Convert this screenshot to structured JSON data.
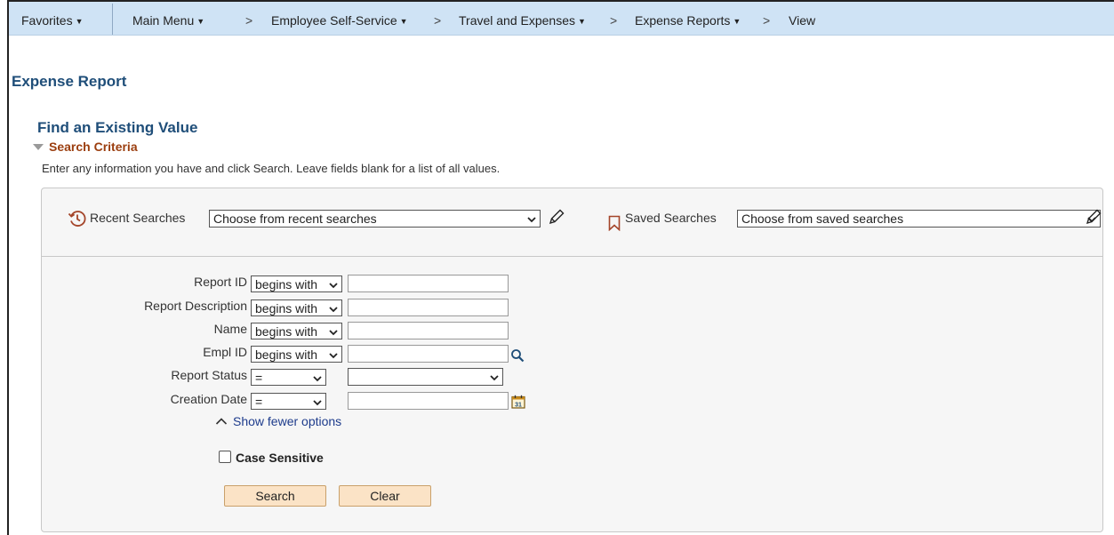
{
  "nav": {
    "favorites": "Favorites",
    "main_menu": "Main Menu",
    "breadcrumbs": [
      "Employee Self-Service",
      "Travel and Expenses",
      "Expense Reports",
      "View"
    ]
  },
  "page": {
    "title": "Expense Report",
    "find_title": "Find an Existing Value",
    "criteria_label": "Search Criteria",
    "instructions": "Enter any information you have and click Search. Leave fields blank for a list of all values."
  },
  "recent": {
    "label": "Recent Searches",
    "value": "Choose from recent searches"
  },
  "saved": {
    "label": "Saved Searches",
    "value": "Choose from saved searches"
  },
  "fields": [
    {
      "label": "Report ID",
      "operator": "begins with",
      "value": ""
    },
    {
      "label": "Report Description",
      "operator": "begins with",
      "value": ""
    },
    {
      "label": "Name",
      "operator": "begins with",
      "value": ""
    },
    {
      "label": "Empl ID",
      "operator": "begins with",
      "value": ""
    },
    {
      "label": "Report Status",
      "operator": "=",
      "value": ""
    },
    {
      "label": "Creation Date",
      "operator": "=",
      "value": ""
    }
  ],
  "show_fewer": "Show fewer options",
  "case_sensitive": {
    "label": "Case Sensitive",
    "checked": false
  },
  "buttons": {
    "search": "Search",
    "clear": "Clear"
  },
  "colors": {
    "nav_bg": "#cfe3f5",
    "title": "#1f4e79",
    "criteria": "#9b3e0f",
    "button_bg": "#fbe3c6"
  }
}
